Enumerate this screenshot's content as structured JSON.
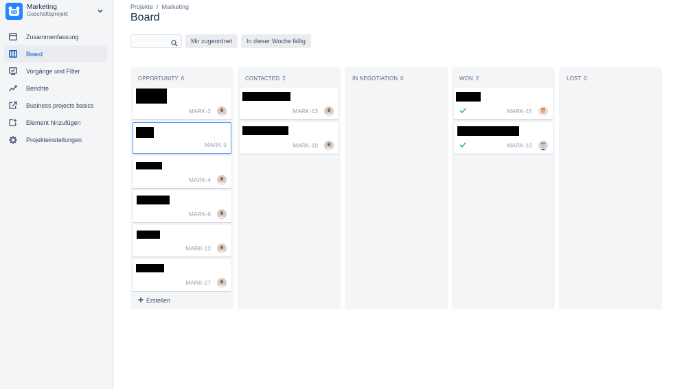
{
  "project": {
    "name": "Marketing",
    "type": "Geschäftsprojekt"
  },
  "sidebar": {
    "items": [
      {
        "label": "Zusammenfassung",
        "icon": "summary-icon",
        "active": false
      },
      {
        "label": "Board",
        "icon": "board-icon",
        "active": true
      },
      {
        "label": "Vorgänge und Filter",
        "icon": "issues-filter-icon",
        "active": false
      },
      {
        "label": "Berichte",
        "icon": "reports-chart-icon",
        "active": false
      },
      {
        "label": "Business projects basics",
        "icon": "external-link-icon",
        "active": false
      },
      {
        "label": "Element hinzufügen",
        "icon": "add-item-icon",
        "active": false
      },
      {
        "label": "Projekteinstellungen",
        "icon": "gear-icon",
        "active": false
      }
    ]
  },
  "breadcrumb": {
    "root": "Projekte",
    "separator": "/",
    "current": "Marketing"
  },
  "page": {
    "title": "Board"
  },
  "toolbar": {
    "search_value": "",
    "filter_mine": "Mir zugeordnet",
    "filter_due_week": "In dieser Woche fällig"
  },
  "board": {
    "columns": [
      {
        "name": "OPPORTUNITY",
        "count": "6",
        "cards": [
          {
            "key": "MARK-2",
            "done": false
          },
          {
            "key": "MARK-3",
            "done": false,
            "selected": true,
            "no_assignee": true
          },
          {
            "key": "MARK-4",
            "done": false
          },
          {
            "key": "MARK-6",
            "done": false
          },
          {
            "key": "MARK-12",
            "done": false
          },
          {
            "key": "MARK-17",
            "done": false
          }
        ],
        "create_label": "Erstellen"
      },
      {
        "name": "CONTACTED",
        "count": "2",
        "cards": [
          {
            "key": "MARK-13",
            "done": false
          },
          {
            "key": "MARK-18",
            "done": false
          }
        ]
      },
      {
        "name": "IN NEGOTIATION",
        "count": "0",
        "cards": []
      },
      {
        "name": "WON",
        "count": "2",
        "cards": [
          {
            "key": "MARK-15",
            "done": true
          },
          {
            "key": "MARK-16",
            "done": true
          }
        ]
      },
      {
        "name": "LOST",
        "count": "0",
        "cards": []
      }
    ]
  },
  "colors": {
    "accent": "#0052cc",
    "done_check": "#36b37e",
    "redaction": "#000000"
  }
}
